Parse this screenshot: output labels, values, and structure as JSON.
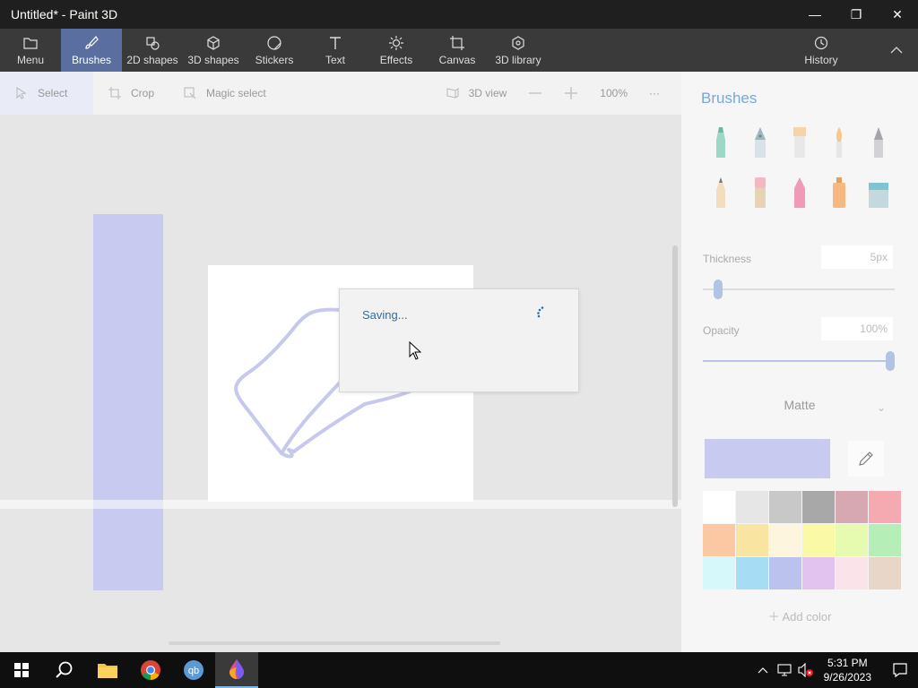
{
  "window": {
    "title": "Untitled* - Paint 3D",
    "minimize": "—",
    "restore": "❐",
    "close": "✕"
  },
  "toolbar": {
    "menu": "Menu",
    "brushes": "Brushes",
    "shapes2d": "2D shapes",
    "shapes3d": "3D shapes",
    "stickers": "Stickers",
    "text": "Text",
    "effects": "Effects",
    "canvas": "Canvas",
    "library3d": "3D library",
    "history": "History"
  },
  "subbar": {
    "select": "Select",
    "crop": "Crop",
    "magic_select": "Magic select",
    "view3d": "3D view",
    "zoom": "100%",
    "more": "···"
  },
  "dialog": {
    "message": "Saving..."
  },
  "panel": {
    "title": "Brushes",
    "thickness_label": "Thickness",
    "thickness_value": "5px",
    "thickness_level": 0.06,
    "opacity_label": "Opacity",
    "opacity_value": "100%",
    "opacity_level": 1.0,
    "finish": "Matte",
    "add_color": "Add color",
    "current_color": "#c8caf0",
    "palette": [
      "#ffffff",
      "#e6e6e6",
      "#c8c8c8",
      "#a8a8a8",
      "#d8a8b2",
      "#f4aab0",
      "#fcc8a4",
      "#fae4a2",
      "#fdf5de",
      "#fafaa6",
      "#e6fab0",
      "#b6eeb8",
      "#d6f8fa",
      "#a6dcf4",
      "#bcc2ee",
      "#e2c2ee",
      "#fae4ea",
      "#e8d6c8"
    ]
  },
  "taskbar": {
    "time": "5:31 PM",
    "date": "9/26/2023"
  }
}
